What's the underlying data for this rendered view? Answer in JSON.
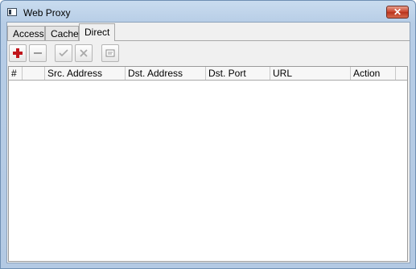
{
  "window": {
    "title": "Web Proxy",
    "close_label": "✕"
  },
  "tabs": [
    {
      "label": "Access"
    },
    {
      "label": "Cache"
    },
    {
      "label": "Direct",
      "active": true
    }
  ],
  "toolbar": {
    "buttons": [
      {
        "name": "add",
        "icon": "plus-icon",
        "color": "#c0151b"
      },
      {
        "name": "remove",
        "icon": "minus-icon"
      },
      {
        "name": "enable",
        "icon": "check-icon"
      },
      {
        "name": "disable",
        "icon": "x-icon"
      },
      {
        "name": "comment",
        "icon": "note-icon"
      }
    ]
  },
  "table": {
    "columns": [
      "#",
      "",
      "Src. Address",
      "Dst. Address",
      "Dst. Port",
      "URL",
      "Action",
      ""
    ],
    "rows": []
  }
}
